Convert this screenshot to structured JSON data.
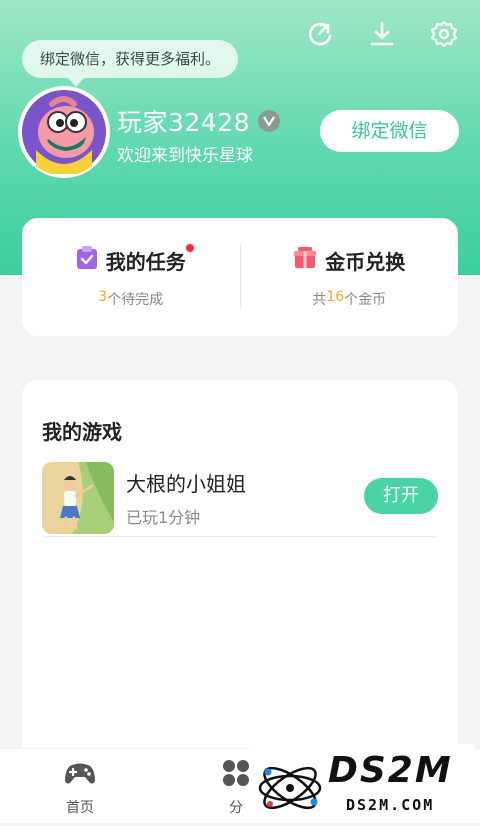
{
  "tooltip": "绑定微信，获得更多福利。",
  "profile": {
    "username": "玩家32428",
    "welcome": "欢迎来到快乐星球",
    "bind_button": "绑定微信",
    "vip_badge": "V"
  },
  "top_icons": [
    "share-icon",
    "download-icon",
    "settings-icon"
  ],
  "tasks_card": {
    "my_tasks_label": "我的任务",
    "pending_count": "3",
    "pending_suffix": "个待完成",
    "exchange_label": "金币兑换",
    "coins_prefix": "共",
    "coins_count": "16",
    "coins_suffix": "个金币"
  },
  "games_card": {
    "title": "我的游戏",
    "games": [
      {
        "name": "大根的小姐姐",
        "played": "已玩1分钟",
        "action": "打开"
      }
    ]
  },
  "tabbar": {
    "tabs": [
      {
        "label": "首页",
        "icon": "gamepad-icon"
      },
      {
        "label": "分",
        "icon": "category-icon"
      }
    ]
  },
  "watermark": {
    "logo": "DS2M",
    "url": "DS2M.COM"
  },
  "colors": {
    "header_gradient_top": "#9fe7c4",
    "header_gradient_bottom": "#3ccf9e",
    "accent_green": "#35c98f",
    "open_button": "#4ad4a6",
    "count_orange": "#f5a623",
    "notification_red": "#ff2b3b"
  }
}
